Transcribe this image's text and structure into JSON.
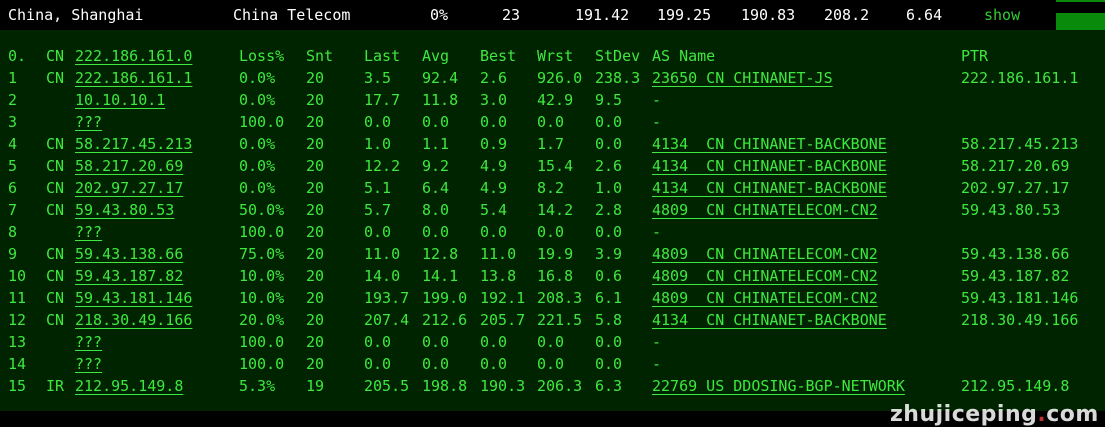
{
  "summary": {
    "location": "China, Shanghai",
    "isp": "China Telecom",
    "loss": "0%",
    "snt": "23",
    "last": "191.42",
    "avg": "199.25",
    "best": "190.83",
    "wrst": "208.2",
    "stdev": "6.64",
    "show_label": "show"
  },
  "table": {
    "headers": {
      "hop": "0.",
      "cc": "CN",
      "host": "222.186.161.0",
      "loss": "Loss%",
      "snt": "Snt",
      "last": "Last",
      "avg": "Avg",
      "best": "Best",
      "wrst": "Wrst",
      "stdev": "StDev",
      "as_name": "AS Name",
      "ptr": "PTR"
    },
    "rows": [
      {
        "hop": "1",
        "cc": "CN",
        "host": "222.186.161.1",
        "loss": "0.0%",
        "snt": "20",
        "last": "3.5",
        "avg": "92.4",
        "best": "2.6",
        "wrst": "926.0",
        "stdev": "238.3",
        "as_name": "23650 CN CHINANET-JS",
        "ptr": "222.186.161.1"
      },
      {
        "hop": "2",
        "cc": "",
        "host": "10.10.10.1",
        "loss": "0.0%",
        "snt": "20",
        "last": "17.7",
        "avg": "11.8",
        "best": "3.0",
        "wrst": "42.9",
        "stdev": "9.5",
        "as_name": "-",
        "ptr": ""
      },
      {
        "hop": "3",
        "cc": "",
        "host": "???",
        "loss": "100.0",
        "snt": "20",
        "last": "0.0",
        "avg": "0.0",
        "best": "0.0",
        "wrst": "0.0",
        "stdev": "0.0",
        "as_name": "-",
        "ptr": ""
      },
      {
        "hop": "4",
        "cc": "CN",
        "host": "58.217.45.213",
        "loss": "0.0%",
        "snt": "20",
        "last": "1.0",
        "avg": "1.1",
        "best": "0.9",
        "wrst": "1.7",
        "stdev": "0.0",
        "as_name": "4134  CN CHINANET-BACKBONE",
        "ptr": "58.217.45.213"
      },
      {
        "hop": "5",
        "cc": "CN",
        "host": "58.217.20.69",
        "loss": "0.0%",
        "snt": "20",
        "last": "12.2",
        "avg": "9.2",
        "best": "4.9",
        "wrst": "15.4",
        "stdev": "2.6",
        "as_name": "4134  CN CHINANET-BACKBONE",
        "ptr": "58.217.20.69"
      },
      {
        "hop": "6",
        "cc": "CN",
        "host": "202.97.27.17",
        "loss": "0.0%",
        "snt": "20",
        "last": "5.1",
        "avg": "6.4",
        "best": "4.9",
        "wrst": "8.2",
        "stdev": "1.0",
        "as_name": "4134  CN CHINANET-BACKBONE",
        "ptr": "202.97.27.17"
      },
      {
        "hop": "7",
        "cc": "CN",
        "host": "59.43.80.53",
        "loss": "50.0%",
        "snt": "20",
        "last": "5.7",
        "avg": "8.0",
        "best": "5.4",
        "wrst": "14.2",
        "stdev": "2.8",
        "as_name": "4809  CN CHINATELECOM-CN2",
        "ptr": "59.43.80.53"
      },
      {
        "hop": "8",
        "cc": "",
        "host": "???",
        "loss": "100.0",
        "snt": "20",
        "last": "0.0",
        "avg": "0.0",
        "best": "0.0",
        "wrst": "0.0",
        "stdev": "0.0",
        "as_name": "-",
        "ptr": ""
      },
      {
        "hop": "9",
        "cc": "CN",
        "host": "59.43.138.66",
        "loss": "75.0%",
        "snt": "20",
        "last": "11.0",
        "avg": "12.8",
        "best": "11.0",
        "wrst": "19.9",
        "stdev": "3.9",
        "as_name": "4809  CN CHINATELECOM-CN2",
        "ptr": "59.43.138.66"
      },
      {
        "hop": "10",
        "cc": "CN",
        "host": "59.43.187.82",
        "loss": "10.0%",
        "snt": "20",
        "last": "14.0",
        "avg": "14.1",
        "best": "13.8",
        "wrst": "16.8",
        "stdev": "0.6",
        "as_name": "4809  CN CHINATELECOM-CN2",
        "ptr": "59.43.187.82"
      },
      {
        "hop": "11",
        "cc": "CN",
        "host": "59.43.181.146",
        "loss": "10.0%",
        "snt": "20",
        "last": "193.7",
        "avg": "199.0",
        "best": "192.1",
        "wrst": "208.3",
        "stdev": "6.1",
        "as_name": "4809  CN CHINATELECOM-CN2",
        "ptr": "59.43.181.146"
      },
      {
        "hop": "12",
        "cc": "CN",
        "host": "218.30.49.166",
        "loss": "20.0%",
        "snt": "20",
        "last": "207.4",
        "avg": "212.6",
        "best": "205.7",
        "wrst": "221.5",
        "stdev": "5.8",
        "as_name": "4134  CN CHINANET-BACKBONE",
        "ptr": "218.30.49.166"
      },
      {
        "hop": "13",
        "cc": "",
        "host": "???",
        "loss": "100.0",
        "snt": "20",
        "last": "0.0",
        "avg": "0.0",
        "best": "0.0",
        "wrst": "0.0",
        "stdev": "0.0",
        "as_name": "-",
        "ptr": ""
      },
      {
        "hop": "14",
        "cc": "",
        "host": "???",
        "loss": "100.0",
        "snt": "20",
        "last": "0.0",
        "avg": "0.0",
        "best": "0.0",
        "wrst": "0.0",
        "stdev": "0.0",
        "as_name": "-",
        "ptr": ""
      },
      {
        "hop": "15",
        "cc": "IR",
        "host": "212.95.149.8",
        "loss": "5.3%",
        "snt": "19",
        "last": "205.5",
        "avg": "198.8",
        "best": "190.3",
        "wrst": "206.3",
        "stdev": "6.3",
        "as_name": "22769 US DDOSING-BGP-NETWORK",
        "ptr": "212.95.149.8"
      }
    ]
  },
  "watermark": {
    "part1": "zhujiceping",
    "dot": ".",
    "part2": "com"
  },
  "colors": {
    "panel_bg": "#002400",
    "text_green": "#3ee83e",
    "meter_green": "#0a8a0a"
  }
}
